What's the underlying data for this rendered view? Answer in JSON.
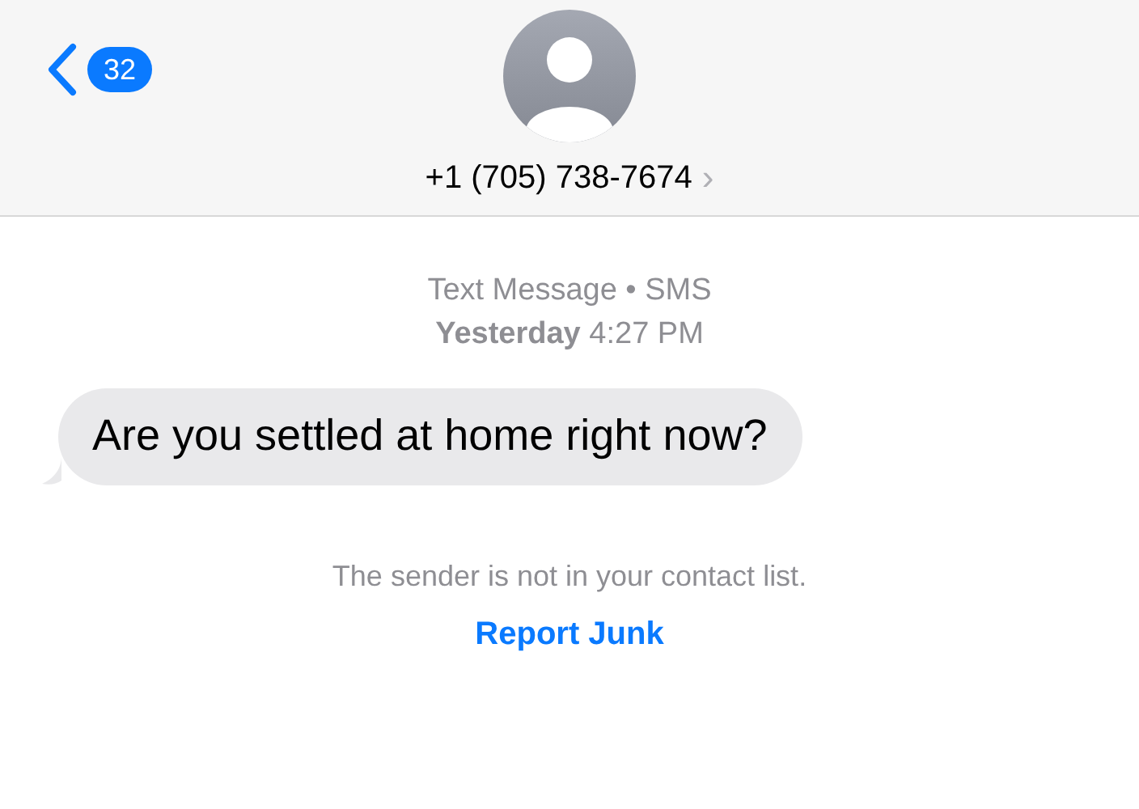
{
  "header": {
    "back_badge": "32",
    "contact": "+1 (705) 738-7674",
    "contact_chevron": "›"
  },
  "conversation": {
    "service": "Text Message • SMS",
    "timestamp": "**Yesterday** 4:27 PM",
    "messages": [
      {
        "text": "Are you settled at home right now?"
      }
    ],
    "notice": "The sender is not in your contact list.",
    "action_link": "Report Junk"
  }
}
